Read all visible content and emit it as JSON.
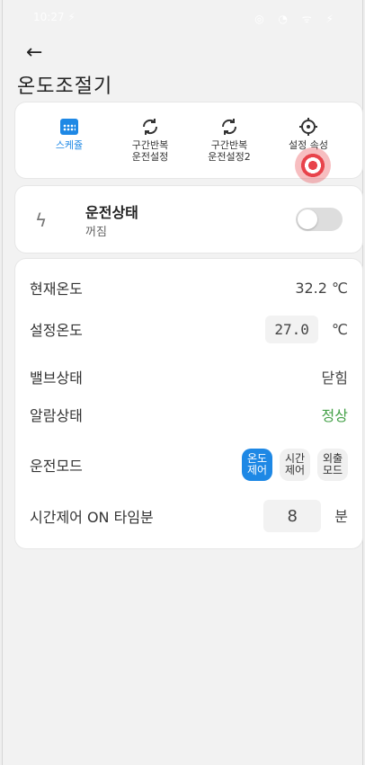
{
  "status_bar": {
    "time": "10:27 ⚡",
    "icons": "◎ ◔ ᯤ ⚡"
  },
  "header": {
    "back_icon": "←",
    "title": "온도조절기"
  },
  "toolbar": {
    "items": [
      {
        "label_line1": "스케쥴",
        "label_line2": "",
        "icon": "calendar-icon",
        "active": true
      },
      {
        "label_line1": "구간반복",
        "label_line2": "운전설정",
        "icon": "refresh-icon"
      },
      {
        "label_line1": "구간반복",
        "label_line2": "운전설정2",
        "icon": "refresh-icon"
      },
      {
        "label_line1": "설정 속성",
        "label_line2": "",
        "icon": "settings-icon"
      }
    ]
  },
  "run_status": {
    "title": "운전상태",
    "state": "꺼짐",
    "icon": "bolt-icon",
    "toggle_on": false
  },
  "info": {
    "current_temp_label": "현재온도",
    "current_temp_value": "32.2 ℃",
    "set_temp_label": "설정온도",
    "set_temp_value": "27.0",
    "set_temp_unit": "℃",
    "valve_label": "밸브상태",
    "valve_value": "닫힘",
    "alarm_label": "알람상태",
    "alarm_value": "정상",
    "mode_label": "운전모드",
    "modes": [
      {
        "line1": "온도",
        "line2": "제어",
        "active": true
      },
      {
        "line1": "시간",
        "line2": "제어",
        "active": false
      },
      {
        "line1": "외출",
        "line2": "모드",
        "active": false
      }
    ],
    "time_on_label": "시간제어 ON 타임분",
    "time_on_value": "8",
    "time_on_unit": "분"
  },
  "colors": {
    "accent": "#1e88e5",
    "ok_green": "#43a047",
    "touch_marker": "#e8434b"
  }
}
